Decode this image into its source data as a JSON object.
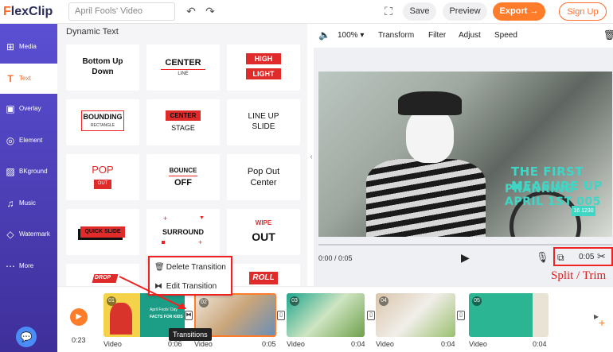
{
  "app": {
    "logo_prefix": "F",
    "logo_rest": "lexClip"
  },
  "topbar": {
    "project_name": "April Fools' Video",
    "undo_icon": "undo-icon",
    "redo_icon": "redo-icon",
    "fullscreen_icon": "fullscreen-icon",
    "save": "Save",
    "preview": "Preview",
    "export": "Export →",
    "signup": "Sign Up"
  },
  "sidebar": {
    "items": [
      {
        "label": "Media",
        "icon": "media-icon"
      },
      {
        "label": "Text",
        "icon": "text-icon"
      },
      {
        "label": "Overlay",
        "icon": "overlay-icon"
      },
      {
        "label": "Element",
        "icon": "element-icon"
      },
      {
        "label": "BKground",
        "icon": "background-icon"
      },
      {
        "label": "Music",
        "icon": "music-icon"
      },
      {
        "label": "Watermark",
        "icon": "watermark-icon"
      },
      {
        "label": "More",
        "icon": "more-icon"
      }
    ]
  },
  "panel": {
    "title": "Dynamic Text",
    "tiles": [
      {
        "lines": [
          "Bottom Up",
          "Down"
        ]
      },
      {
        "lines": [
          "CENTER",
          "LINE"
        ]
      },
      {
        "lines": [
          "HIGH",
          "LIGHT"
        ]
      },
      {
        "lines": [
          "BOUNDING",
          "RECTANGLE"
        ]
      },
      {
        "lines": [
          "CENTER",
          "STAGE"
        ]
      },
      {
        "lines": [
          "LINE UP",
          "SLIDE"
        ]
      },
      {
        "lines": [
          "POP",
          "OUT"
        ]
      },
      {
        "lines": [
          "BOUNCE",
          "OFF"
        ]
      },
      {
        "lines": [
          "Pop Out",
          "Center"
        ]
      },
      {
        "lines": [
          "QUICK SLIDE"
        ]
      },
      {
        "lines": [
          "SURROUND"
        ]
      },
      {
        "lines": [
          "WIPE",
          "OUT"
        ]
      },
      {
        "lines": [
          "DROP"
        ]
      },
      {
        "lines": []
      },
      {
        "lines": [
          "ROLL"
        ]
      }
    ]
  },
  "editor_bar": {
    "volume_icon": "volume-icon",
    "zoom": "100%",
    "transform": "Transform",
    "filter": "Filter",
    "adjust": "Adjust",
    "speed": "Speed",
    "delete_icon": "trash-icon"
  },
  "preview": {
    "overlay_line1": "THE FIRST MEASURE UP",
    "overlay_line2": "PRANKING APRIL 1ST 005",
    "overlay_badge": "16 1230",
    "timecode": "0:00 / 0:05",
    "duration": "0:05"
  },
  "split_trim_label": "Split / Trim",
  "context_menu": {
    "delete": "Delete Transition",
    "edit": "Edit Transition"
  },
  "timeline": {
    "total": "0:23",
    "tooltip": "Transitions",
    "clips": [
      {
        "num": "01",
        "label": "Video",
        "duration": "0:06"
      },
      {
        "num": "02",
        "label": "Video",
        "duration": "0:05"
      },
      {
        "num": "03",
        "label": "Video",
        "duration": "0:04"
      },
      {
        "num": "04",
        "label": "Video",
        "duration": "0:04"
      },
      {
        "num": "05",
        "label": "Video",
        "duration": "0:04"
      }
    ],
    "clip1_text": "April Fools' Day",
    "clip1_sub": "FACTS FOR KIDS"
  },
  "colors": {
    "accent": "#ff7c2a",
    "sidebar": "#4b3fc0",
    "highlight": "#e22222",
    "teal": "#3fd6c6"
  }
}
